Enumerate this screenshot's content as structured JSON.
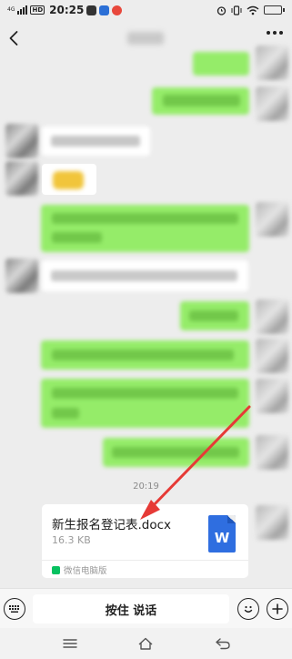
{
  "status_bar": {
    "network": "4G",
    "hd_badge": "HD",
    "time": "20:25",
    "battery_percent": 40
  },
  "chat": {
    "timestamp": "20:19",
    "file_message": {
      "file_name": "新生报名登记表.docx",
      "file_size": "16.3 KB",
      "file_type_letter": "W",
      "source": "微信电脑版"
    }
  },
  "input_bar": {
    "hold_to_talk": "按住 说话"
  },
  "colors": {
    "outgoing_bubble": "#95ec69",
    "incoming_bubble": "#ffffff",
    "background": "#ededed",
    "annotation_arrow": "#e63a36",
    "word_icon": "#2f6ee0"
  },
  "icons": {
    "back": "back-icon",
    "more": "more-icon",
    "keyboard": "keyboard-icon",
    "emoji": "emoji-icon",
    "add": "plus-icon",
    "word_file": "word-file-icon"
  }
}
